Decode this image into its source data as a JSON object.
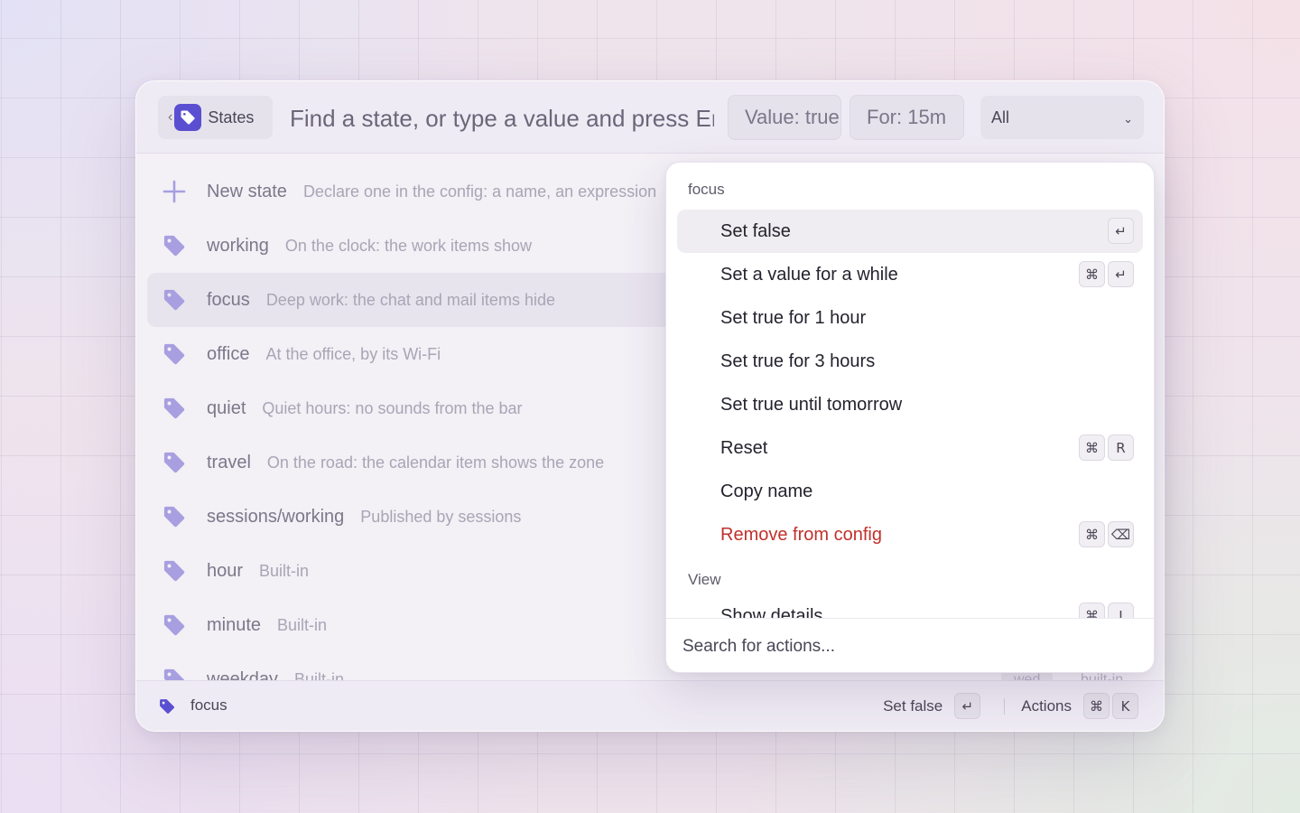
{
  "header": {
    "back_label": "States",
    "search_placeholder": "Find a state, or type a value and press Enter",
    "value_chip": "Value: true",
    "for_chip": "For: 15m",
    "filter_value": "All"
  },
  "states": [
    {
      "name": "New state",
      "description": "Declare one in the config: a name, an expression",
      "icon": "plus-icon"
    },
    {
      "name": "working",
      "description": "On the clock: the work items show",
      "icon": "tag-icon"
    },
    {
      "name": "focus",
      "description": "Deep work: the chat and mail items hide",
      "icon": "tag-icon",
      "selected": true
    },
    {
      "name": "office",
      "description": "At the office, by its Wi-Fi",
      "icon": "tag-icon"
    },
    {
      "name": "quiet",
      "description": "Quiet hours: no sounds from the bar",
      "icon": "tag-icon"
    },
    {
      "name": "travel",
      "description": "On the road: the calendar item shows the zone",
      "icon": "tag-icon"
    },
    {
      "name": "sessions/working",
      "description": "Published by sessions",
      "icon": "tag-icon"
    },
    {
      "name": "hour",
      "description": "Built-in",
      "icon": "tag-icon"
    },
    {
      "name": "minute",
      "description": "Built-in",
      "icon": "tag-icon"
    },
    {
      "name": "weekday",
      "description": "Built-in",
      "icon": "tag-icon",
      "value": "wed",
      "kind": "built-in"
    }
  ],
  "footer": {
    "selected_state": "focus",
    "primary_action": "Set false",
    "primary_key": "↵",
    "actions_label": "Actions",
    "actions_keys": [
      "⌘",
      "K"
    ]
  },
  "actions_popover": {
    "section_title": "focus",
    "items": [
      {
        "label": "Set false",
        "keys": [
          "↵"
        ],
        "active": true
      },
      {
        "label": "Set a value for a while",
        "keys": [
          "⌘",
          "↵"
        ]
      },
      {
        "label": "Set true for 1 hour",
        "keys": []
      },
      {
        "label": "Set true for 3 hours",
        "keys": []
      },
      {
        "label": "Set true until tomorrow",
        "keys": []
      },
      {
        "label": "Reset",
        "keys": [
          "⌘",
          "R"
        ]
      },
      {
        "label": "Copy name",
        "keys": []
      },
      {
        "label": "Remove from config",
        "keys": [
          "⌘",
          "⌫"
        ],
        "danger": true
      }
    ],
    "view_section_title": "View",
    "view_items": [
      {
        "label": "Show details",
        "keys": [
          "⌘",
          "I"
        ]
      }
    ],
    "search_placeholder": "Search for actions..."
  },
  "colors": {
    "accent": "#5b4fd1",
    "tag_icon": "#a79fe0",
    "danger": "#c0312b"
  }
}
